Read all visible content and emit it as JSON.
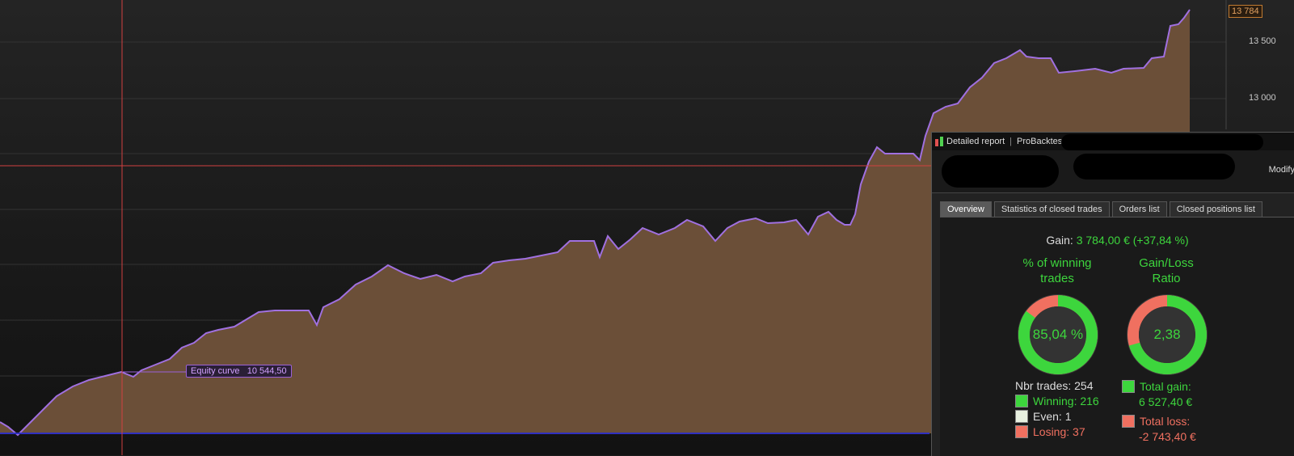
{
  "chart": {
    "y_ticks": [
      {
        "label": "13 500",
        "value": 13500
      },
      {
        "label": "13 000",
        "value": 13000
      }
    ],
    "last_value_label": "13 784",
    "equity_tag": {
      "name": "Equity curve",
      "value": "10 544,50"
    },
    "colors": {
      "line": "#a070e0",
      "fill": "#6b4f38",
      "crosshair": "#d04040",
      "baseline": "#3030c0"
    }
  },
  "report": {
    "title": "Detailed report",
    "subtitle": "ProBacktest",
    "modify_label": "Modify",
    "tabs": [
      {
        "label": "Overview",
        "active": true
      },
      {
        "label": "Statistics of closed trades",
        "active": false
      },
      {
        "label": "Orders list",
        "active": false
      },
      {
        "label": "Closed positions list",
        "active": false
      }
    ],
    "gain_label": "Gain:",
    "gain_value": "3 784,00 € (+37,84 %)",
    "winning_title_1": "% of winning",
    "winning_title_2": "trades",
    "winning_value": "85,04 %",
    "winning_fraction": 0.8504,
    "ratio_title_1": "Gain/Loss",
    "ratio_title_2": "Ratio",
    "ratio_value": "2,38",
    "ratio_fraction": 0.704,
    "nbr_trades": "Nbr trades: 254",
    "winning": "Winning: 216",
    "even": "Even: 1",
    "losing": "Losing: 37",
    "total_gain_label": "Total gain:",
    "total_gain_value": "6 527,40 €",
    "total_loss_label": "Total loss:",
    "total_loss_value": "-2 743,40 €",
    "colors": {
      "green": "#3dd63d",
      "red": "#f07060",
      "white": "#e8f0e0"
    }
  }
}
